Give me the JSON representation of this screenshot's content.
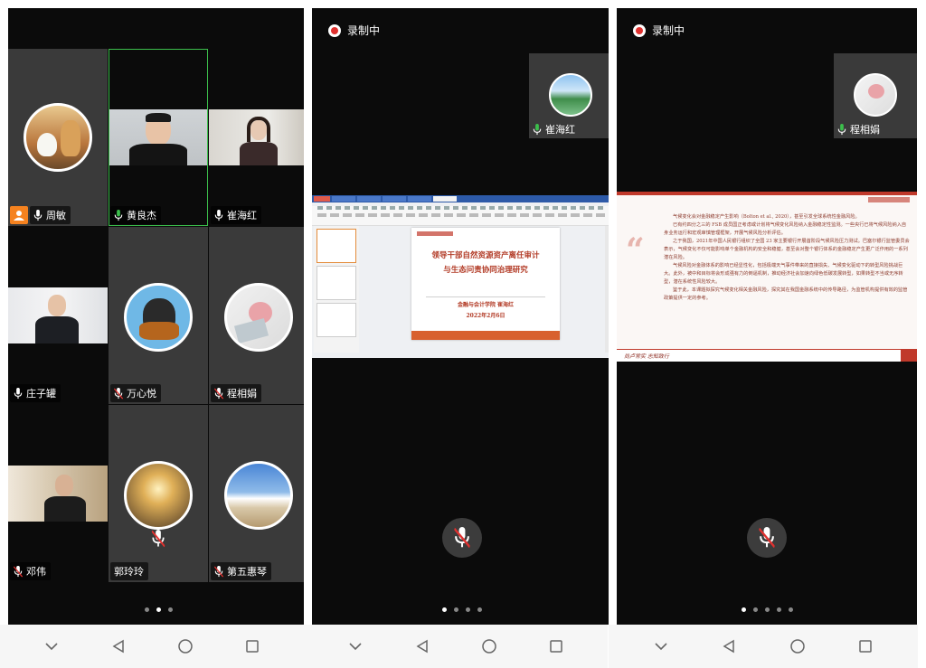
{
  "phone1": {
    "tiles": [
      {
        "name": "周敏",
        "host": true
      },
      {
        "name": "黄良杰"
      },
      {
        "name": "崔海红"
      },
      {
        "name": "庄子罐"
      },
      {
        "name": "万心悦",
        "muted": true
      },
      {
        "name": "程相娟",
        "muted": true
      },
      {
        "name": "邓伟",
        "muted": true
      },
      {
        "name": "郭玲玲",
        "no_mic_icon": true
      },
      {
        "name": "第五惠琴",
        "muted": true
      }
    ],
    "page_dots": 3,
    "page_active": 2
  },
  "phone2": {
    "recording_label": "录制中",
    "self_name": "崔海红",
    "slide": {
      "title_line1": "领导干部自然资源资产离任审计",
      "title_line2": "与生态问责协同治理研究",
      "author": "金融与会计学院   崔海红",
      "date": "2022年2月6日"
    },
    "page_dots": 4,
    "page_active": 1
  },
  "phone3": {
    "recording_label": "录制中",
    "self_name": "程相娟",
    "slide": {
      "p1": "气候变化会对金融稳定产生影响（Bolton et al., 2020），甚至引发全球系统性金融风险。",
      "p2": "已有约四分之三的 FSB 成员国正考虑或计划将气候变化风险纳入金融稳定性监测。一些央行已将气候风险纳入自身业务运行和宏观审慎管理框架，开展气候风险分析评估。",
      "p3": "之于我国，2021年中国人民银行组织了全国 23 家主要银行开展首阶段气候风险压力测试。巴塞尔银行监管委员会表示，气候变化不仅可能影响单个金融机构的安全和稳健，甚至会对整个银行体系的金融稳定产生更广泛作用的一系列潜在风险。",
      "p4": "气候风险对金融体系的影响已经显性化，包括极端天气事件带来的直接损失、气候变化驱动下的转型风险挑战巨大。此外，被中和目标将会形成强有力的倒逼机制，推动经济社会加速向绿色低碳发展转型，如果转型不当或无序转型，潜在系统性风险较大。",
      "p5": "鉴于此，本课题拟探究气候变化相关金融风险，探究其在我国金融系统中的传导路径，为监管机构提供有效的监管政策提供一定的参考。",
      "footer": "尚卢常实  志知致行"
    },
    "page_dots": 5,
    "page_active": 1
  },
  "colors": {
    "tile": "#3a3a3a",
    "active_border": "#3cbf4c",
    "host_orange": "#f5821f",
    "rec_red": "#e0312f",
    "slide_red": "#c0392b"
  }
}
